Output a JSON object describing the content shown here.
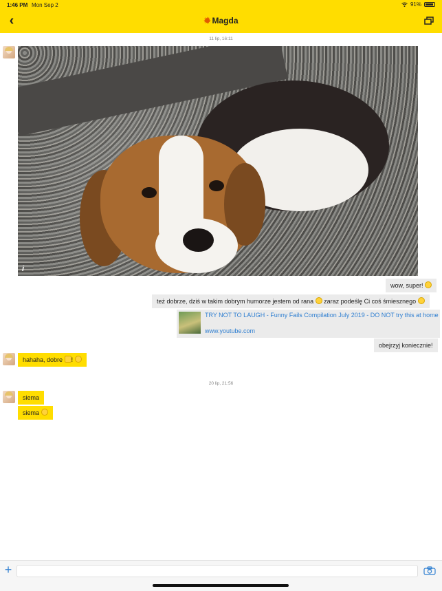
{
  "status_bar": {
    "time": "1:46 PM",
    "date": "Mon Sep 2",
    "battery": "91%"
  },
  "header": {
    "title": "Magda"
  },
  "conversation": {
    "timestamp_1": "11 lip, 16:11",
    "timestamp_2": "20 lip, 21:56",
    "messages": {
      "m1": "wow, super!",
      "m2": "też dobrze, dziś w takim dobrym humorze jestem od rana",
      "m2b": "zaraz podeślę Ci coś śmiesznego",
      "m3": "obejrzyj koniecznie!",
      "m4": "hahaha, dobre",
      "m5": "siema",
      "m6": "siema"
    },
    "link": {
      "title": "TRY NOT TO LAUGH - Funny Fails Compilation July 2019 - DO NOT try this at home",
      "url": "www.youtube.com"
    },
    "photo_info": "i"
  },
  "colors": {
    "accent": "#ffdd00",
    "link": "#2f7fd1",
    "outgoing": "#ebebeb"
  },
  "icons": [
    "back-chevron-icon",
    "sun-icon",
    "windows-icon",
    "info-icon",
    "plus-icon",
    "camera-icon",
    "wifi-icon",
    "battery-icon"
  ]
}
